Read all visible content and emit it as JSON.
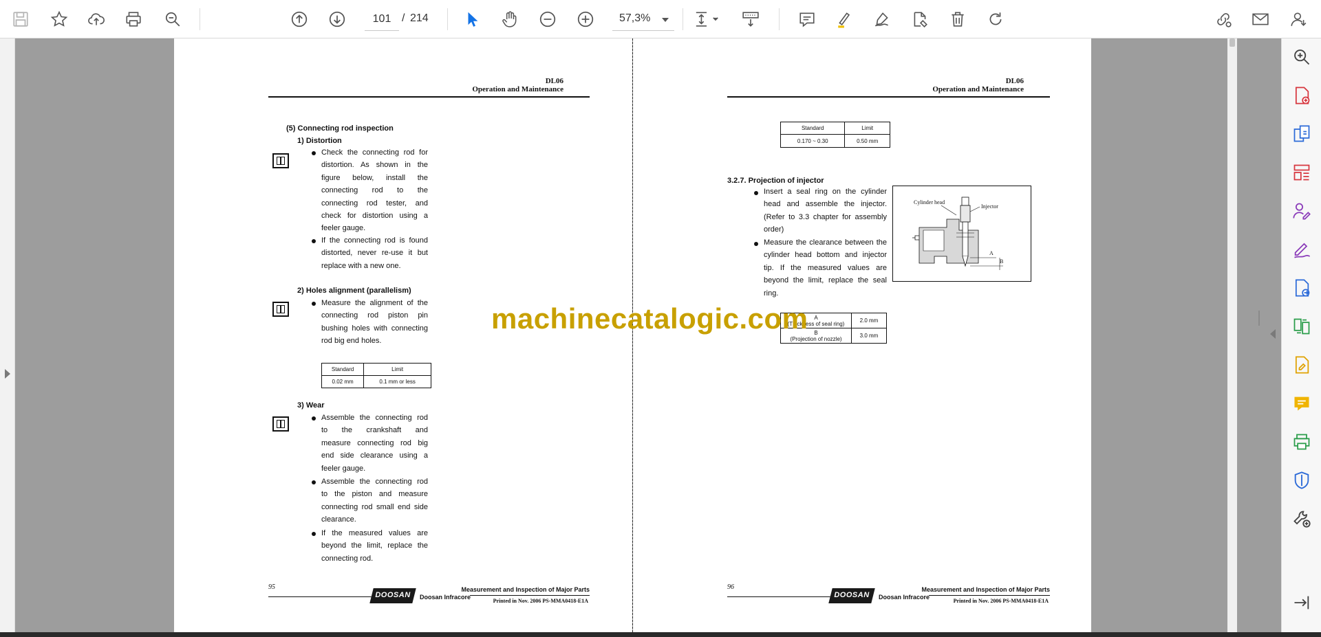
{
  "toolbar": {
    "page_current": "101",
    "page_separator": "/",
    "page_total": "214",
    "zoom": "57,3%",
    "icons": [
      "save-icon",
      "bookmark-star-icon",
      "upload-cloud-icon",
      "print-icon",
      "search-zoom-icon",
      "page-up-icon",
      "page-down-icon",
      "select-cursor-icon",
      "hand-pan-icon",
      "zoom-out-icon",
      "zoom-in-icon",
      "page-fit-icon",
      "scroll-mode-icon",
      "comment-icon",
      "highlight-icon",
      "draw-icon",
      "sign-icon",
      "delete-icon",
      "rotate-icon",
      "share-link-icon",
      "email-icon",
      "account-icon"
    ]
  },
  "colors": {
    "accent": "#1473e6",
    "viewport_bg": "#9d9d9d",
    "watermark": "#c8a000"
  },
  "watermark": "machinecatalogic.com",
  "left_page": {
    "header_model": "DL06",
    "header_sub": "Operation and Maintenance",
    "section_title": "(5) Connecting rod inspection",
    "sub1_title": "1)  Distortion",
    "sub1_bullets": [
      [
        "Check the connecting rod for",
        "distortion. As shown in the",
        "figure below, install the",
        "connecting rod to the",
        "connecting rod tester, and",
        "check for distortion using a",
        "feeler gauge."
      ],
      [
        "If the connecting rod is found",
        "distorted, never re-use it but",
        "replace with a new one."
      ]
    ],
    "sub2_title": "2)  Holes alignment (parallelism)",
    "sub2_bullets": [
      [
        "Measure the alignment of the",
        "connecting rod piston pin",
        "bushing holes with connecting",
        "rod big end holes."
      ]
    ],
    "table": {
      "headers": [
        "Standard",
        "Limit"
      ],
      "row": [
        "0.02 mm",
        "0.1 mm or less"
      ]
    },
    "sub3_title": "3)  Wear",
    "sub3_bullets": [
      [
        "Assemble the connecting rod",
        "to the crankshaft and",
        "measure connecting rod big",
        "end side clearance using a",
        "feeler gauge."
      ],
      [
        "Assemble the connecting rod",
        "to the piston and measure",
        "connecting rod small end side",
        "clearance."
      ],
      [
        "If the measured values are",
        "beyond the limit, replace the",
        "connecting rod."
      ]
    ],
    "footer_page": "95",
    "footer_logo": "DOOSAN",
    "footer_company": "Doosan Infracore",
    "footer_title": "Measurement and Inspection of Major Parts",
    "footer_print": "Printed in Nov. 2006    PS-MMA0418-E1A"
  },
  "right_page": {
    "header_model": "DL06",
    "header_sub": "Operation and Maintenance",
    "top_table": {
      "headers": [
        "Standard",
        "Limit"
      ],
      "row": [
        "0.170 ~ 0.30",
        "0.50 mm"
      ]
    },
    "section_title": "3.2.7. Projection of injector",
    "bullets": [
      [
        "Insert a seal ring on the cylinder",
        "head and assemble the injector.",
        "(Refer to 3.3 chapter for assembly",
        "order)"
      ],
      [
        "Measure the clearance between the",
        "cylinder head bottom and injector",
        "tip. If the measured values are",
        "beyond the limit, replace the seal",
        "ring."
      ]
    ],
    "figure_labels": {
      "cylinder_head": "Cylinder head",
      "injector": "Injector",
      "a": "A",
      "b": "B"
    },
    "spec_table": [
      {
        "label_top": "A",
        "label_bottom": "(Thickness of seal ring)",
        "value": "2.0 mm"
      },
      {
        "label_top": "B",
        "label_bottom": "(Projection of nozzle)",
        "value": "3.0 mm"
      }
    ],
    "footer_page": "96",
    "footer_logo": "DOOSAN",
    "footer_company": "Doosan Infracore",
    "footer_title": "Measurement and Inspection of Major Parts",
    "footer_print": "Printed in Nov. 2006    PS-MMA0418-E1A"
  },
  "tools_rail": [
    "zoom-search-icon",
    "create-pdf-icon",
    "combine-files-icon",
    "organize-pages-icon",
    "request-signature-icon",
    "fill-sign-icon",
    "export-pdf-icon",
    "compare-files-icon",
    "edit-pdf-icon",
    "comment-tool-icon",
    "print-production-icon",
    "protect-shield-icon",
    "more-tools-icon",
    "collapse-panel-icon"
  ]
}
